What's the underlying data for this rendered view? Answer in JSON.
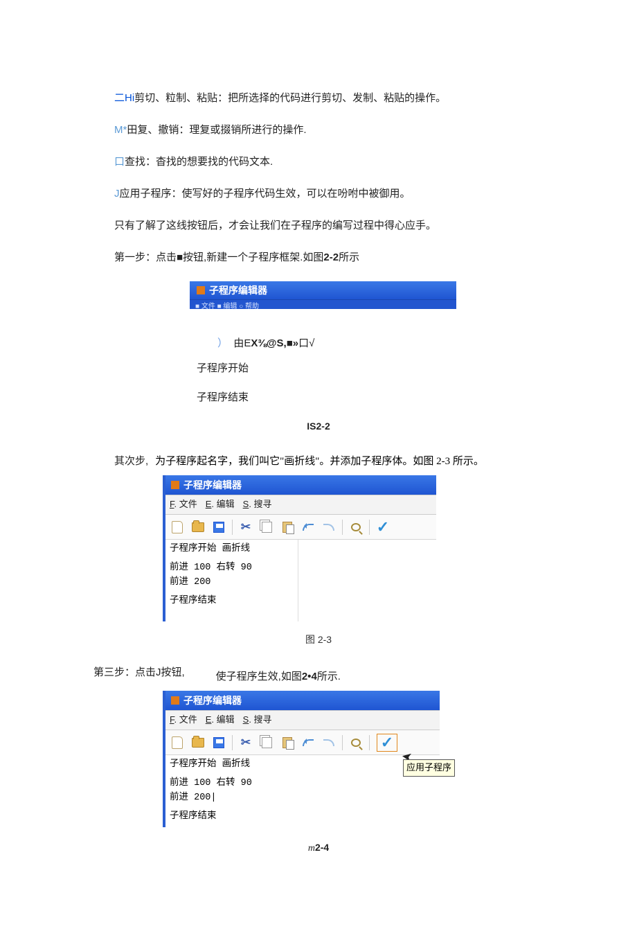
{
  "text": {
    "t1_prefix": "二Hi",
    "t1_rest": "剪切、粒制、粘贴：把所选择的代码进行剪切、发制、粘贴的操作。",
    "t2_prefix": "M*",
    "t2_rest": "田复、撤销：理复或掇销所进行的操作.",
    "t3_prefix": "口",
    "t3_rest": "查找：杳找的想要找的代码文本.",
    "t4_prefix": "J",
    "t4_rest": "应用子程序：使写好的子程序代码生效，可以在吩咐中被御用。",
    "t5": "只有了解了这线按钮后，才会让我们在子程序的编写过程中得心应手。",
    "t6": "第一步：点击■按钮,新建一个子程序框架.如图",
    "t6_bold": "2-2",
    "t6_end": "所示"
  },
  "fig22": {
    "title": "子程序编辑器",
    "stub": "■ 文件  ■ 编辑  ○ 帮助",
    "garbled_paren": "）",
    "garbled_rest": "由E",
    "garbled_bold": "X⅜@S,■»",
    "garbled_tail": "口√",
    "line1": "子程序开始",
    "line2": "子程序结束",
    "caption": "IS2-2"
  },
  "step2": {
    "left": "其次步,",
    "right": "为子程序起名字，我们叫它\"画折线\"。并添加子程序体。如图 2-3 所示。"
  },
  "fig23": {
    "title": "子程序编辑器",
    "menu": {
      "file_u": "F",
      "file": ". 文件",
      "edit_u": "E",
      "edit": ". 编辑",
      "search_u": "S",
      "search": ". 搜寻"
    },
    "code": {
      "l1": "子程序开始 画折线",
      "l2": "前进 100 右转 90",
      "l3": "前进 200",
      "l4": "子程序结束"
    },
    "caption": "图 2-3"
  },
  "step3": {
    "left": "第三步：点击J按钮,",
    "right_a": "使子程序生效,如图",
    "right_b": "2•4",
    "right_c": "所示."
  },
  "fig24": {
    "title": "子程序编辑器",
    "menu": {
      "file_u": "F",
      "file": ". 文件",
      "edit_u": "E",
      "edit": ". 编辑",
      "search_u": "S",
      "search": ". 搜寻"
    },
    "code": {
      "l1": "子程序开始 画折线",
      "l2": "前进 100 右转 90",
      "l3": "前进 200|",
      "l4": "子程序结束"
    },
    "tooltip": "应用子程序",
    "caption_a_i": "m",
    "caption_a": "2-4"
  },
  "icons": {
    "cut": "✂",
    "check": "✓",
    "cursor": "↖"
  }
}
